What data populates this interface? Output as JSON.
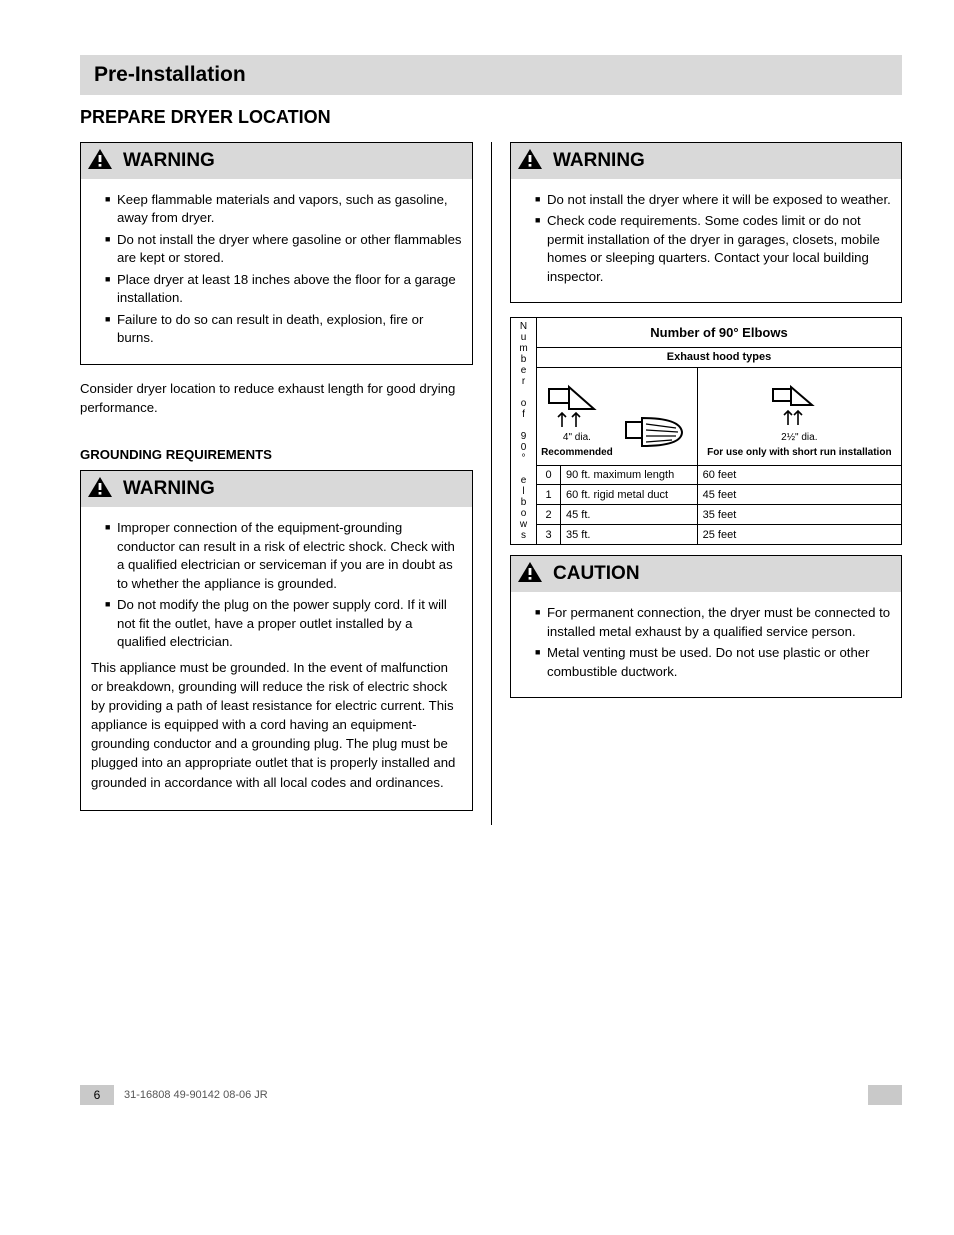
{
  "header": {
    "title": "Pre-Installation"
  },
  "section_heading": "PREPARE DRYER LOCATION",
  "page_number": "6",
  "doc_name": "31-16808   49-90142   08-06 JR",
  "left_col": {
    "warn1": {
      "label": "WARNING",
      "paras": [
        "Keep flammable materials and vapors, such as gasoline, away from dryer.",
        "Do not install the dryer where gasoline or other flammables are kept or stored.",
        "Place dryer at least 18 inches above the floor for a garage installation.",
        "Failure to do so can result in death, explosion, fire or burns."
      ]
    },
    "para1": "Consider dryer location to reduce exhaust length for good drying performance.",
    "sub1": "GROUNDING REQUIREMENTS",
    "warn2": {
      "label": "WARNING",
      "paras": [
        "Improper connection of the equipment-grounding conductor can result in a risk of electric shock. Check with a qualified electrician or serviceman if you are in doubt as to whether the appliance is grounded.",
        "Do not modify the plug on the power supply cord. If it will not fit the outlet, have a proper outlet installed by a qualified electrician.",
        "This appliance must be grounded. In the event of malfunction or breakdown, grounding will reduce the risk of electric shock by providing a path of least resistance for electric current. This appliance is equipped with a cord having an equipment-grounding conductor and a grounding plug. The plug must be plugged into an appropriate outlet that is properly installed and grounded in accordance with all local codes and ordinances."
      ]
    }
  },
  "right_col": {
    "warn1": {
      "label": "WARNING",
      "paras": [
        "Do not install the dryer where it will be exposed to weather.",
        "Check code requirements. Some codes limit or do not permit installation of the dryer in garages, closets, mobile homes or sleeping quarters. Contact your local building inspector."
      ]
    },
    "vent_table": {
      "title": "Number of 90° Elbows",
      "type_header": "Exhaust hood types",
      "hoods": {
        "h1": {
          "caption": "4\" dia.",
          "label": "Recommended"
        },
        "h2": {
          "caption": "",
          "label": ""
        },
        "h3": {
          "caption": "2½\" dia.",
          "label": "For use only with short run installation"
        }
      },
      "rows": [
        [
          "0",
          "90 ft. maximum length",
          "60 feet"
        ],
        [
          "1",
          "60 ft. rigid metal duct",
          "45 feet"
        ],
        [
          "2",
          "45 ft.",
          "35 feet"
        ],
        [
          "3",
          "35 ft.",
          "25 feet"
        ]
      ],
      "side_label": "N\nu\nm\nb\ne\nr\n\no\nf\n\n9\n0\n°\n\ne\nl\nb\no\nw\ns"
    },
    "warn2": {
      "label": "CAUTION",
      "paras": [
        "For permanent connection, the dryer must be connected to installed metal exhaust by a qualified service person.",
        "Metal venting must be used. Do not use plastic or other combustible ductwork."
      ]
    }
  }
}
